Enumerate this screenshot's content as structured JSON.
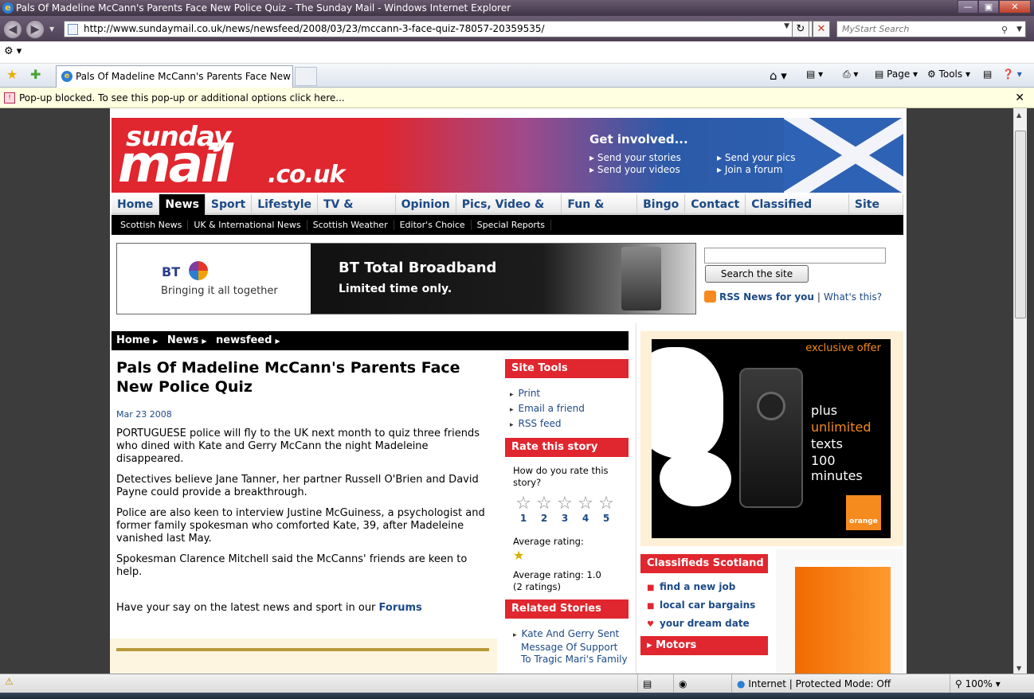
{
  "browser": {
    "window_title": "Pals Of Madeline McCann's Parents Face New Police Quiz - The Sunday Mail - Windows Internet Explorer",
    "url": "http://www.sundaymail.co.uk/news/newsfeed/2008/03/23/mccann-3-face-quiz-78057-20359535/",
    "search_placeholder": "MyStart Search",
    "tab_title": "Pals Of Madeline McCann's Parents Face New Po...",
    "page_label": "Page",
    "tools_label": "Tools",
    "popup_message": "Pop-up blocked. To see this pop-up or additional options click here...",
    "status_zone": "Internet | Protected Mode: Off",
    "zoom": "100%"
  },
  "banner": {
    "logo_top": "sunday",
    "logo_main": "mail",
    "logo_suffix": ".co.uk",
    "get_involved": "Get involved...",
    "links": [
      "Send your stories",
      "Send your videos",
      "Send your pics",
      "Join a forum"
    ]
  },
  "nav": {
    "main": [
      "Home",
      "News",
      "Sport",
      "Lifestyle",
      "TV & Showbiz",
      "Opinion",
      "Pics, Video & Audio",
      "Fun & Games",
      "Bingo",
      "Contact",
      "Classified Scotland",
      "Site Map"
    ],
    "active": "News",
    "sub": [
      "Scottish News",
      "UK & International News",
      "Scottish Weather",
      "Editor's Choice",
      "Special Reports"
    ]
  },
  "ad_bt": {
    "logo": "BT",
    "tagline": "Bringing it all together",
    "headline": "BT Total Broadband",
    "subline": "Limited time only."
  },
  "site_search": {
    "button": "Search the site",
    "rss_label": "RSS News for you",
    "whats_this": "What's this?"
  },
  "breadcrumb": [
    "Home",
    "News",
    "newsfeed"
  ],
  "article": {
    "title": "Pals Of Madeline McCann's Parents Face New Police Quiz",
    "date": "Mar 23 2008",
    "paragraphs": [
      "PORTUGUESE police will fly to the UK next month to quiz three friends who dined with Kate and Gerry McCann the night Madeleine disappeared.",
      "Detectives believe Jane Tanner, her partner Russell O'Brien and David Payne could provide a breakthrough.",
      "Police are also keen to interview Justine McGuiness, a psychologist and former family spokesman who comforted Kate, 39, after Madeleine vanished last May.",
      "Spokesman Clarence Mitchell said the McCanns' friends are keen to help."
    ],
    "forums_text": "Have your say on the latest news and sport in our",
    "forums_link": "Forums"
  },
  "site_tools": {
    "header": "Site Tools",
    "links": [
      "Print",
      "Email a friend",
      "RSS feed"
    ]
  },
  "rating": {
    "header": "Rate this story",
    "question": "How do you rate this story?",
    "numbers": [
      "1",
      "2",
      "3",
      "4",
      "5"
    ],
    "avg_label": "Average rating:",
    "avg_text": "Average rating: 1.0",
    "count": "(2 ratings)"
  },
  "related": {
    "header": "Related Stories",
    "items": [
      "Kate And Gerry Sent Message Of Support To Tragic Mari's Family"
    ]
  },
  "sony_ad": {
    "exclusive": "exclusive offer",
    "line1": "plus",
    "line2": "unlimited",
    "line3": "texts",
    "line4": "100 minutes",
    "brand": "orange"
  },
  "classifieds": {
    "header": "Classifieds Scotland",
    "links": [
      "find a new job",
      "local car bargains",
      "your dream date"
    ],
    "motors": "Motors"
  }
}
